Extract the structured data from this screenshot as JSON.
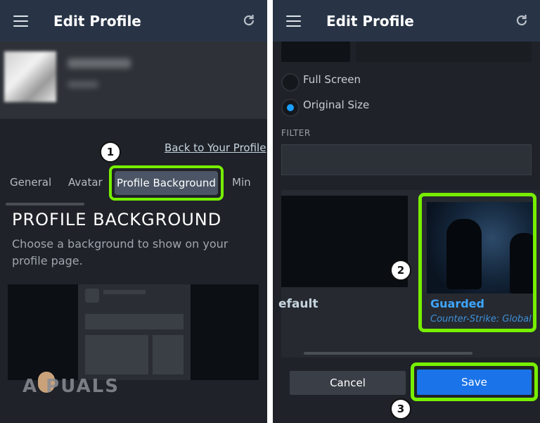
{
  "left": {
    "header": {
      "title": "Edit Profile"
    },
    "back_link": "Back to Your Profile",
    "tabs": [
      "General",
      "Avatar",
      "Profile Background",
      "Min"
    ],
    "section": {
      "heading": "PROFILE BACKGROUND",
      "description": "Choose a background to show on your profile page."
    },
    "step_badge": "1",
    "watermark": "A  PUALS"
  },
  "right": {
    "header": {
      "title": "Edit Profile"
    },
    "display_options": [
      {
        "label": "Full Screen",
        "selected": false
      },
      {
        "label": "Original Size",
        "selected": true
      }
    ],
    "filter_label": "FILTER",
    "filter_value": "",
    "cards": [
      {
        "name": "efault"
      },
      {
        "name": "Guarded",
        "game": "Counter-Strike: Global"
      }
    ],
    "step_badges": [
      "2",
      "3"
    ],
    "buttons": {
      "cancel": "Cancel",
      "save": "Save"
    }
  },
  "colors": {
    "highlight": "#77ee00",
    "accent_blue": "#1a73e8",
    "header_bg": "#283446",
    "panel_bg": "#1f2228"
  },
  "icons": [
    "hamburger-menu-icon",
    "refresh-icon"
  ]
}
